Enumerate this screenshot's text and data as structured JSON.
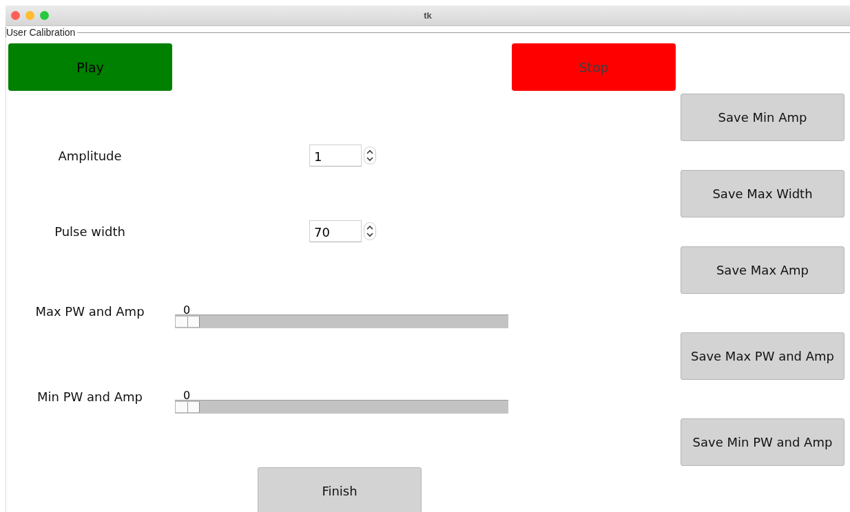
{
  "window": {
    "title": "tk"
  },
  "group": {
    "label": "User Calibration"
  },
  "top_buttons": [
    {
      "label": "Play",
      "color": "#008000",
      "disabled": false
    },
    {
      "label": "Stop",
      "color": "#ff0000",
      "disabled": true
    }
  ],
  "spinboxes": [
    {
      "label": "Amplitude",
      "value": "1"
    },
    {
      "label": "Pulse width",
      "value": "70"
    }
  ],
  "sliders": [
    {
      "label": "Max PW and Amp",
      "reading": "0",
      "level": 0
    },
    {
      "label": "Min PW and Amp",
      "reading": "0",
      "level": 0
    }
  ],
  "save_buttons": [
    "Save Min Amp",
    "Save Max Width",
    "Save Max Amp",
    "Save Max PW and Amp",
    "Save Min PW and Amp"
  ],
  "finish_button": {
    "label": "Finish"
  }
}
